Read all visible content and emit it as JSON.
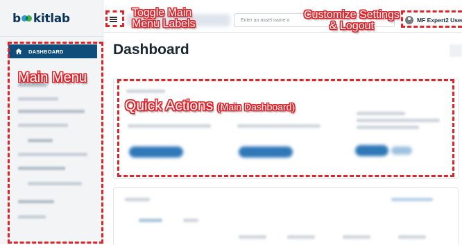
{
  "app": {
    "logo_text_left": "b",
    "logo_text_right": "kitlab",
    "brand_colors": {
      "navy": "#0e3557",
      "blue": "#2b9ad6",
      "green": "#43b649"
    }
  },
  "sidebar": {
    "active_item": {
      "label": "DASHBOARD",
      "icon": "home-icon"
    }
  },
  "header": {
    "search": {
      "placeholder": "Enter an asset name o",
      "value": ""
    },
    "user": {
      "label": "MF Expert2 User",
      "icon": "user-avatar-icon"
    }
  },
  "main": {
    "title": "Dashboard"
  },
  "annotations": {
    "color": "#e0242b",
    "toggle_menu_line1": "Toggle Main",
    "toggle_menu_line2": "Menu Labels",
    "customize_line1": "Customize Settings",
    "customize_line2": "& Logout",
    "main_menu": "Main Menu",
    "quick_actions": "Quick Actions",
    "quick_actions_note": "(Main Dashboard)"
  }
}
